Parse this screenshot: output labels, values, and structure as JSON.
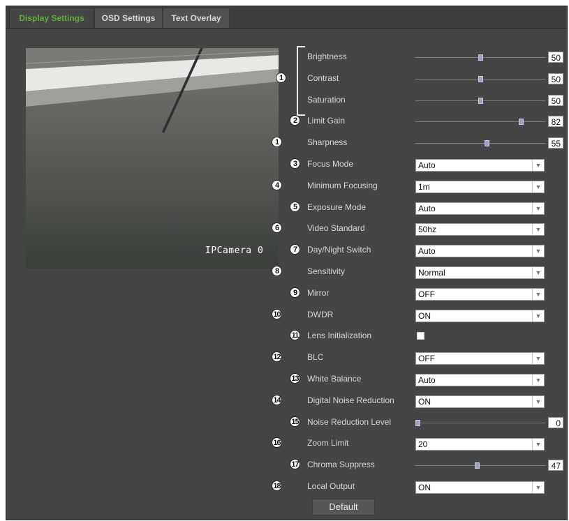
{
  "tabs": [
    {
      "label": "Display Settings",
      "active": true
    },
    {
      "label": "OSD Settings",
      "active": false
    },
    {
      "label": "Text Overlay",
      "active": false
    }
  ],
  "preview": {
    "camera_label": "IPCamera 0"
  },
  "sliders": [
    {
      "marker": "1",
      "label": "Brightness",
      "value": "50",
      "level": 0.5
    },
    {
      "marker": "1",
      "label": "Contrast",
      "value": "50",
      "level": 0.5
    },
    {
      "marker": "1",
      "label": "Saturation",
      "value": "50",
      "level": 0.5
    },
    {
      "marker": "2",
      "label": "Limit Gain",
      "value": "82",
      "level": 0.82
    },
    {
      "marker": "1",
      "label": "Sharpness",
      "value": "55",
      "level": 0.55
    }
  ],
  "selects": [
    {
      "marker": "3",
      "label": "Focus Mode",
      "value": "Auto"
    },
    {
      "marker": "4",
      "label": "Minimum Focusing",
      "value": "1m"
    },
    {
      "marker": "5",
      "label": "Exposure Mode",
      "value": "Auto"
    },
    {
      "marker": "6",
      "label": "Video Standard",
      "value": "50hz"
    },
    {
      "marker": "7",
      "label": "Day/Night Switch",
      "value": "Auto"
    },
    {
      "marker": "8",
      "label": "Sensitivity",
      "value": "Normal"
    },
    {
      "marker": "9",
      "label": "Mirror",
      "value": "OFF"
    },
    {
      "marker": "10",
      "label": "DWDR",
      "value": "ON"
    }
  ],
  "lens_init": {
    "marker": "11",
    "label": "Lens Initialization",
    "checked": false
  },
  "selects2": [
    {
      "marker": "12",
      "label": "BLC",
      "value": "OFF"
    },
    {
      "marker": "13",
      "label": "White Balance",
      "value": "Auto"
    },
    {
      "marker": "14",
      "label": "Digital Noise Reduction",
      "value": "ON"
    }
  ],
  "noise_level": {
    "marker": "15",
    "label": "Noise Reduction Level",
    "value": "0",
    "level": 0.0
  },
  "zoom_limit": {
    "marker": "16",
    "label": "Zoom Limit",
    "value": "20"
  },
  "chroma": {
    "marker": "17",
    "label": "Chroma Suppress",
    "value": "47",
    "level": 0.47
  },
  "local_output": {
    "marker": "18",
    "label": "Local Output",
    "value": "ON"
  },
  "default_button": "Default",
  "colors": {
    "accent": "#5fae3b",
    "panel": "#454545"
  }
}
